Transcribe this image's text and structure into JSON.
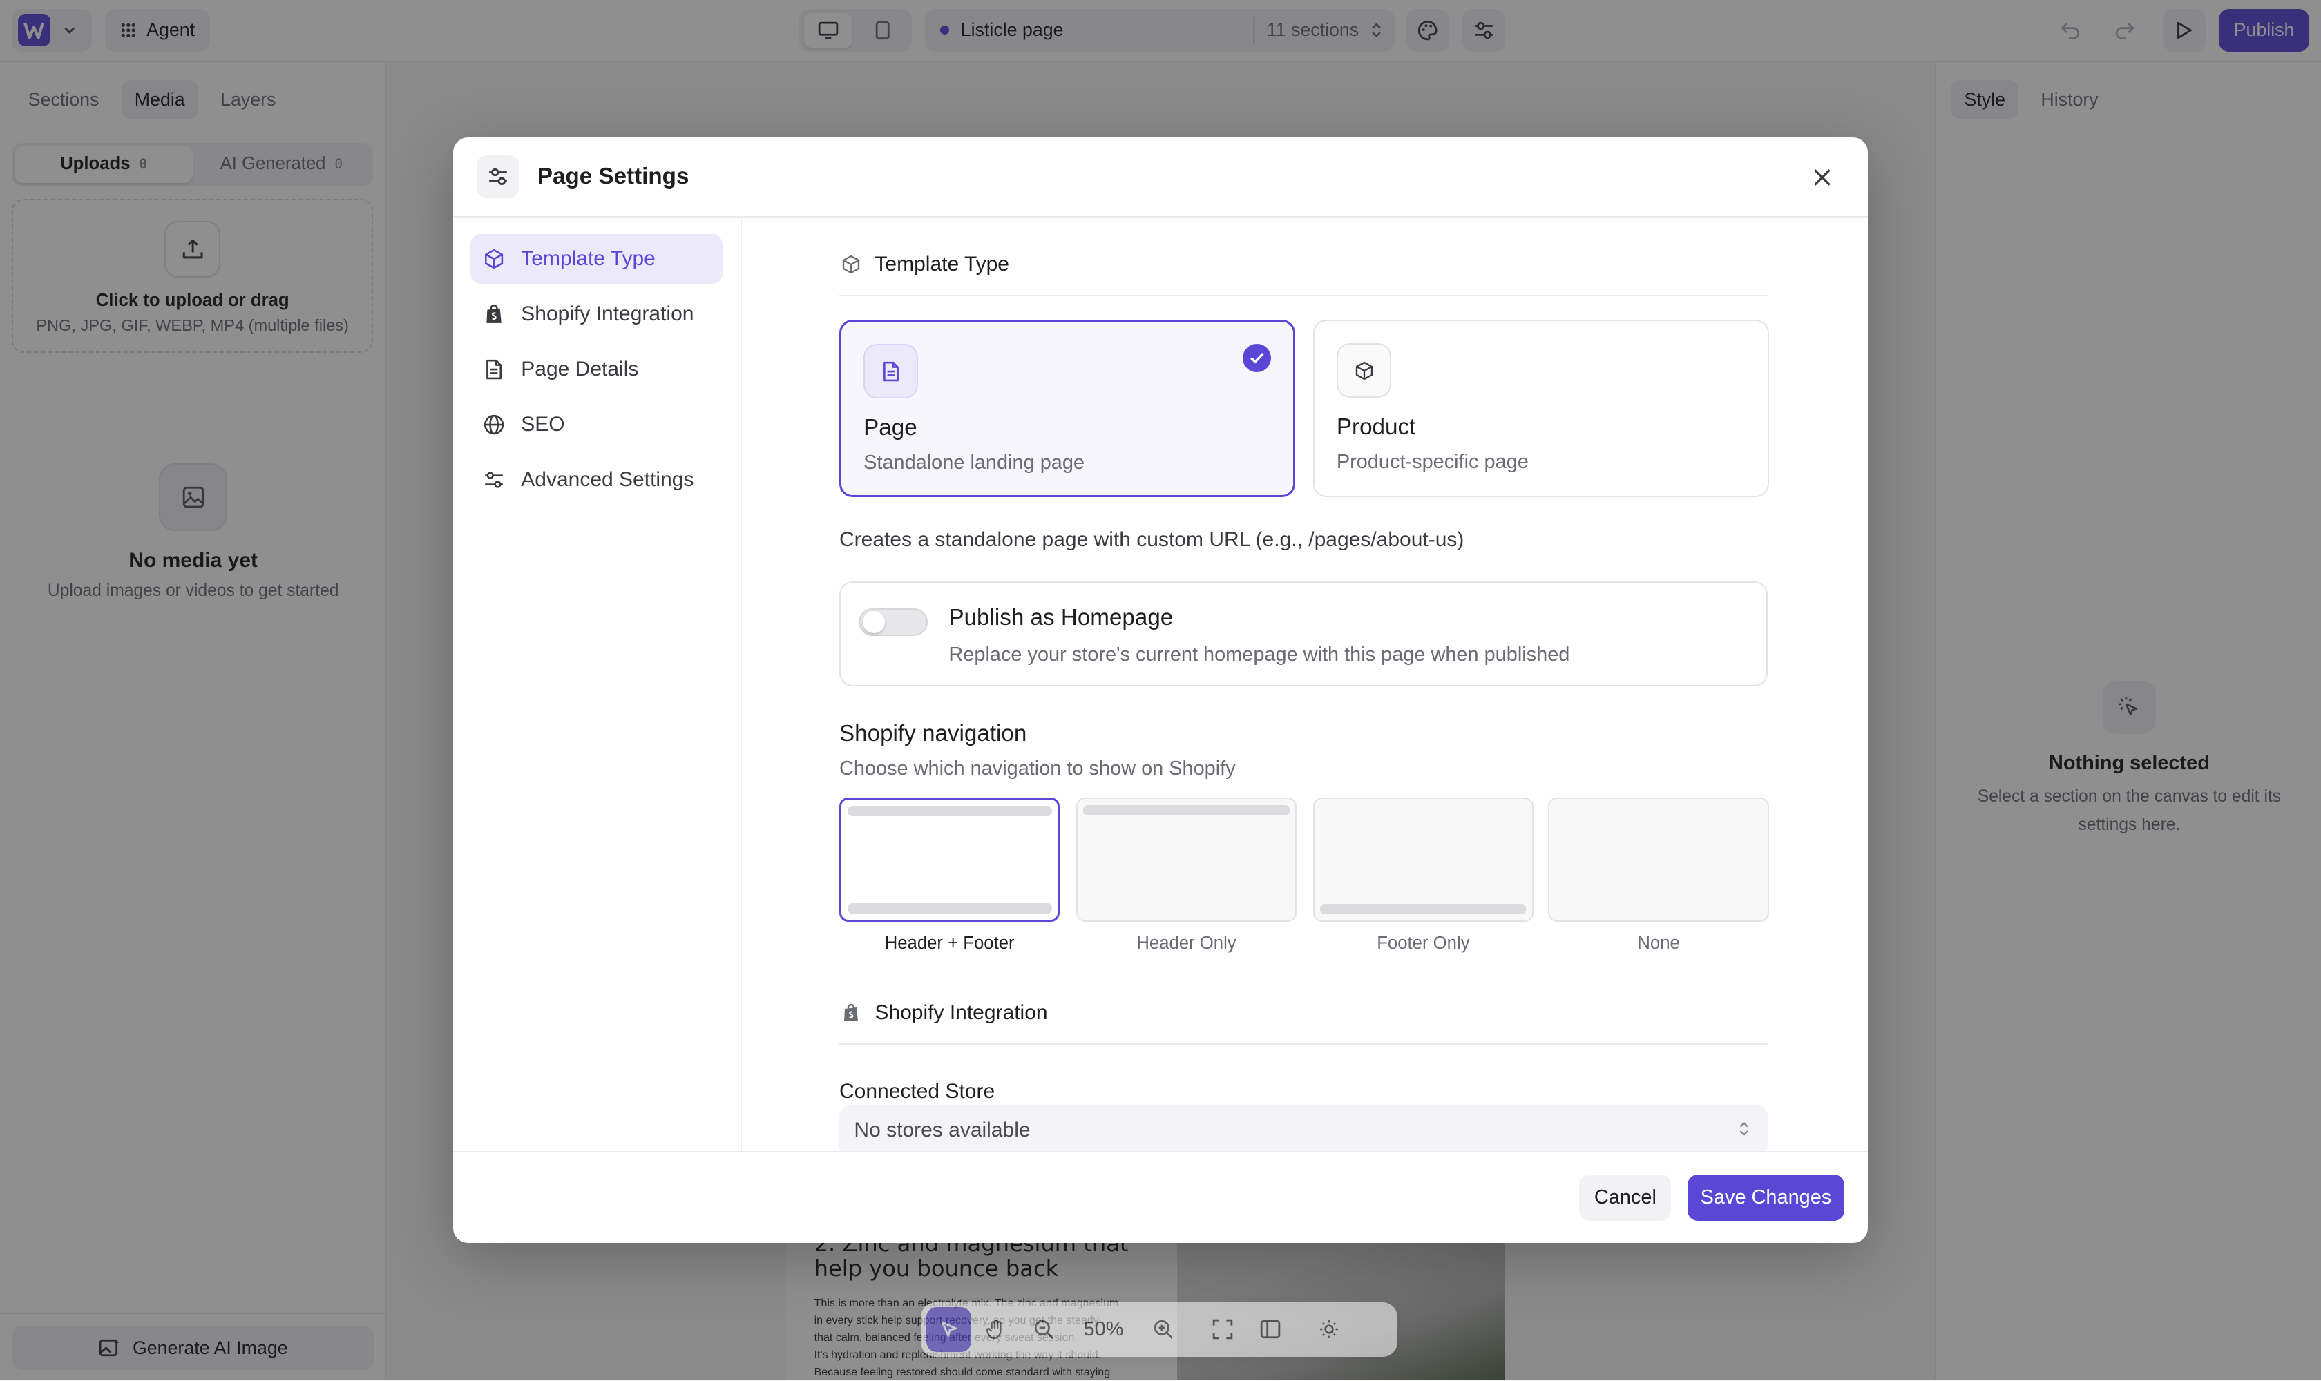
{
  "topbar": {
    "agent_label": "Agent",
    "page_name": "Listicle page",
    "sections_count": "11 sections",
    "publish_label": "Publish"
  },
  "left_panel": {
    "tabs": [
      "Sections",
      "Media",
      "Layers"
    ],
    "active_tab": "Media",
    "uploads_label": "Uploads",
    "uploads_count": "0",
    "ai_generated_label": "AI Generated",
    "ai_generated_count": "0",
    "upload_title": "Click to upload or drag",
    "upload_formats": "PNG, JPG, GIF, WEBP, MP4 (multiple files)",
    "empty_title": "No media yet",
    "empty_subtitle": "Upload images or videos to get started",
    "generate_label": "Generate AI Image"
  },
  "right_panel": {
    "tabs": [
      "Style",
      "History"
    ],
    "active_tab": "Style",
    "empty_title": "Nothing selected",
    "empty_subtitle": "Select a section on the canvas to edit its settings here."
  },
  "canvas": {
    "heading": "2. Zinc and magnesium that help you bounce back",
    "body_lines": [
      "This is more than an electrolyte mix. The zinc and magnesium",
      "in every stick help support recovery, so you get the steady",
      "that calm, balanced feeling after every sweat session.",
      "It's hydration and replenishment working the way it should.",
      "Because feeling restored should come standard with staying"
    ],
    "zoom": "50%"
  },
  "modal": {
    "title": "Page Settings",
    "nav": [
      {
        "label": "Template Type",
        "icon": "cube-icon"
      },
      {
        "label": "Shopify Integration",
        "icon": "shopify-bag-icon"
      },
      {
        "label": "Page Details",
        "icon": "document-icon"
      },
      {
        "label": "SEO",
        "icon": "globe-icon"
      },
      {
        "label": "Advanced Settings",
        "icon": "sliders-icon"
      }
    ],
    "active_nav": "Template Type",
    "template_section_title": "Template Type",
    "template_options": [
      {
        "title": "Page",
        "subtitle": "Standalone landing page",
        "selected": true
      },
      {
        "title": "Product",
        "subtitle": "Product-specific page",
        "selected": false
      }
    ],
    "template_description": "Creates a standalone page with custom URL (e.g., /pages/about-us)",
    "homepage_title": "Publish as Homepage",
    "homepage_subtitle": "Replace your store's current homepage with this page when published",
    "homepage_enabled": false,
    "nav_title": "Shopify navigation",
    "nav_subtitle": "Choose which navigation to show on Shopify",
    "nav_options": [
      "Header + Footer",
      "Header Only",
      "Footer Only",
      "None"
    ],
    "nav_selected": "Header + Footer",
    "shopify_section_title": "Shopify Integration",
    "connected_store_label": "Connected Store",
    "connected_store_value": "No stores available",
    "cancel_label": "Cancel",
    "save_label": "Save Changes"
  },
  "colors": {
    "accent": "#5b47d6",
    "accent_soft": "#ece9fb"
  }
}
